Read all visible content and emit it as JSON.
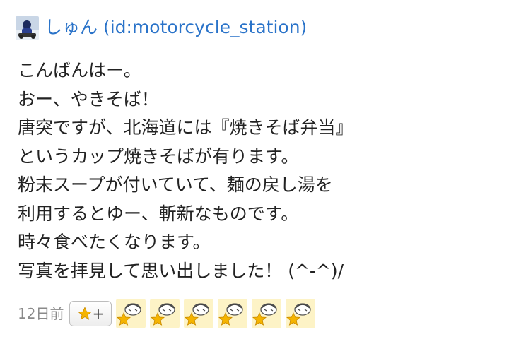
{
  "comment": {
    "author": {
      "name": "しゅん (id:motorcycle_station)"
    },
    "lines": [
      "こんばんはー。",
      "おー、やきそば！",
      "唐突ですが、北海道には『焼きそば弁当』",
      "というカップ焼きそばが有ります。",
      "粉末スープが付いていて、麺の戻し湯を",
      "利用するとゆー、斬新なものです。",
      "時々食べたくなります。",
      "写真を拝見して思い出しました！ (^-^)/"
    ],
    "timestamp": "12日前",
    "add_star_plus": "+",
    "stars": [
      {
        "icon": "user-star-icon"
      },
      {
        "icon": "user-star-icon"
      },
      {
        "icon": "user-star-icon"
      },
      {
        "icon": "user-star-icon"
      },
      {
        "icon": "user-star-icon"
      },
      {
        "icon": "user-star-icon"
      }
    ]
  },
  "colors": {
    "author_link": "#2a73c9",
    "text": "#222222",
    "timestamp": "#8a8a8a",
    "star": "#f5b400",
    "star_bg": "#fdf3c6"
  }
}
